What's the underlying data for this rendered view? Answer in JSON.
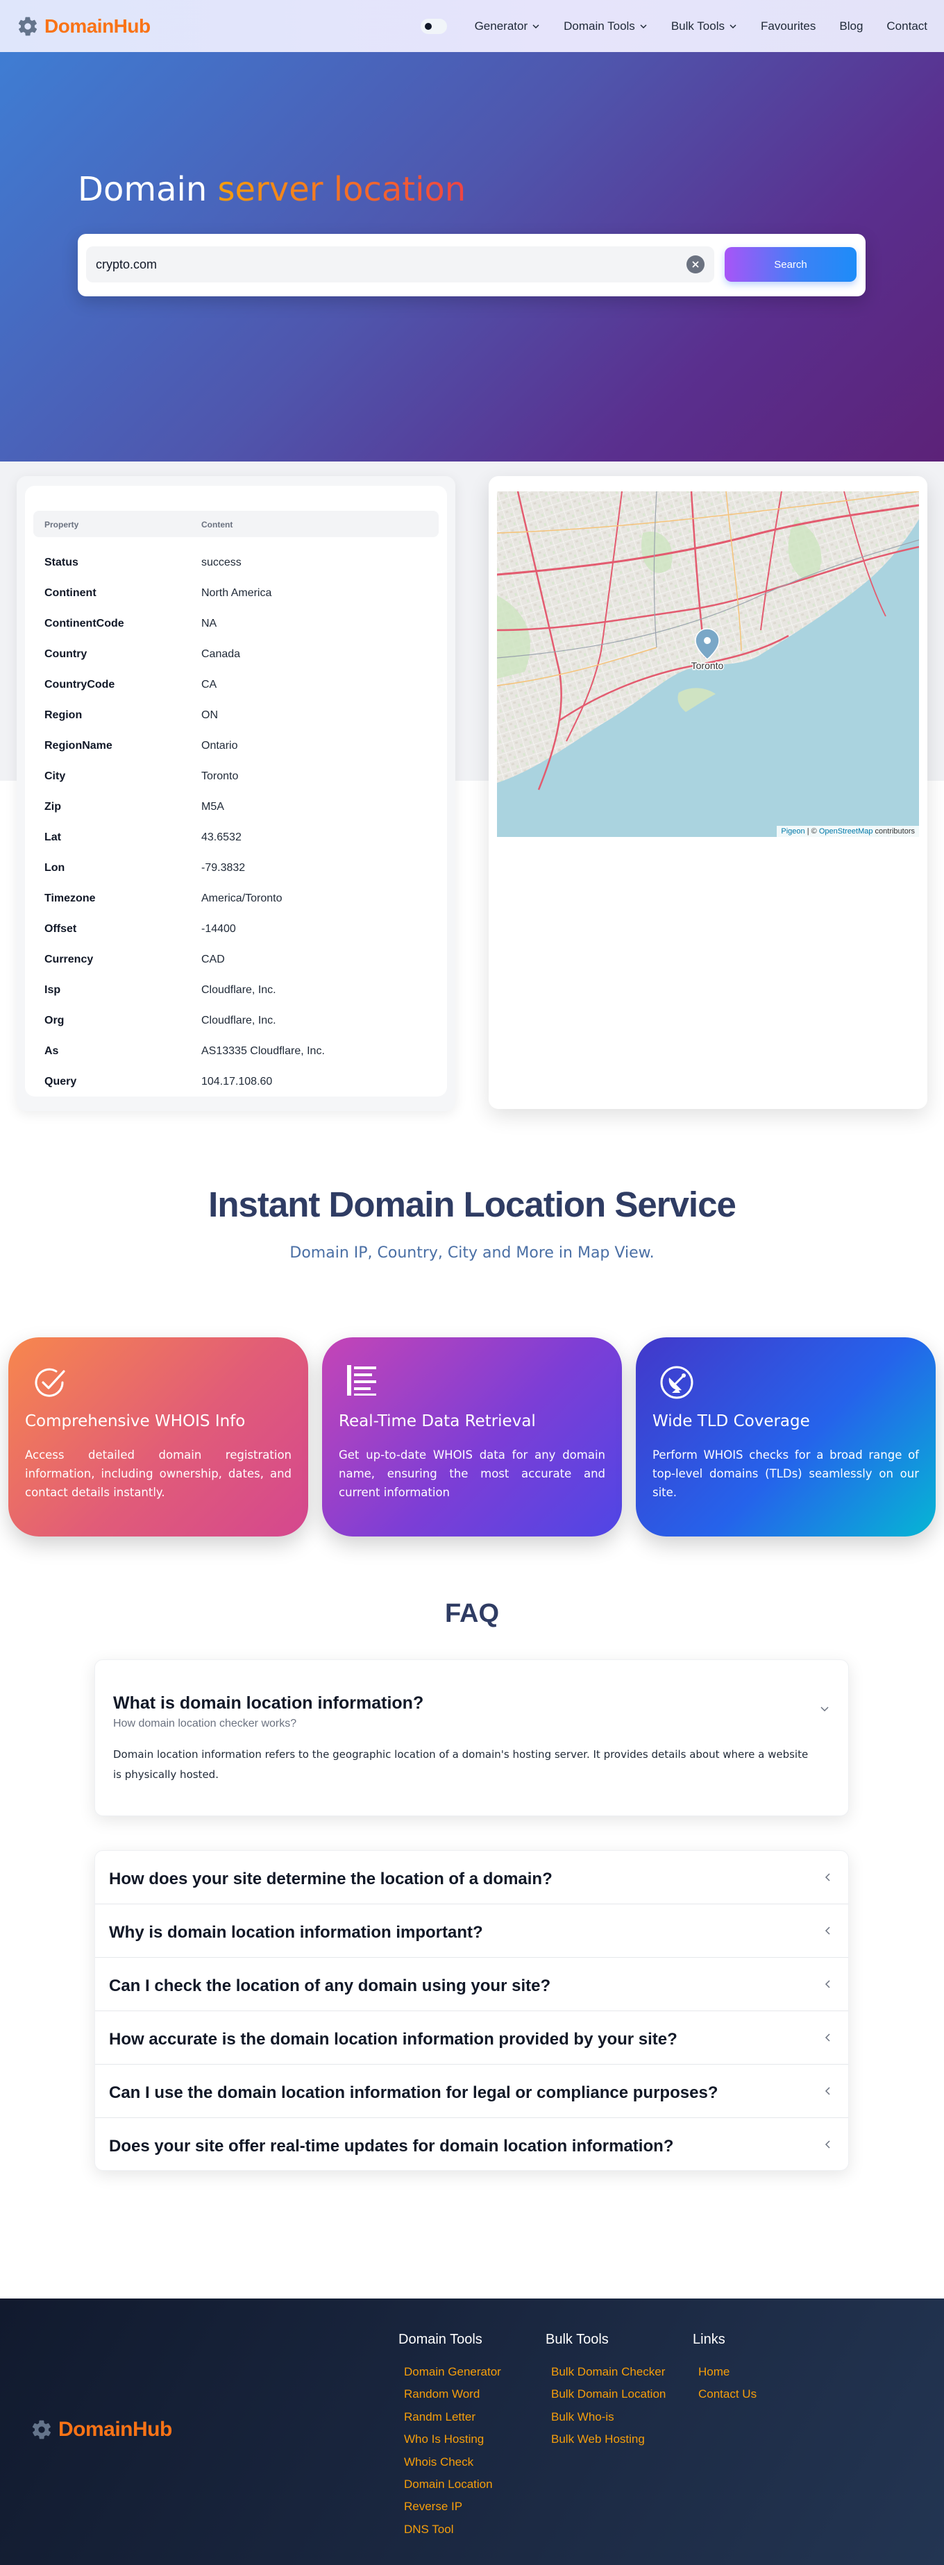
{
  "brand": {
    "name": "DomainHub",
    "logo_icon": "gear-icon"
  },
  "nav": {
    "items": [
      {
        "label": "Generator",
        "dropdown": true
      },
      {
        "label": "Domain Tools",
        "dropdown": true
      },
      {
        "label": "Bulk Tools",
        "dropdown": true
      },
      {
        "label": "Favourites",
        "dropdown": false
      },
      {
        "label": "Blog",
        "dropdown": false
      },
      {
        "label": "Contact",
        "dropdown": false
      }
    ]
  },
  "hero": {
    "title_plain": "Domain",
    "title_accent": "server location",
    "search_value": "crypto.com",
    "search_button": "Search"
  },
  "table": {
    "header_property": "Property",
    "header_content": "Content",
    "rows": [
      {
        "k": "Status",
        "v": "success"
      },
      {
        "k": "Continent",
        "v": "North America"
      },
      {
        "k": "ContinentCode",
        "v": "NA"
      },
      {
        "k": "Country",
        "v": "Canada"
      },
      {
        "k": "CountryCode",
        "v": "CA"
      },
      {
        "k": "Region",
        "v": "ON"
      },
      {
        "k": "RegionName",
        "v": "Ontario"
      },
      {
        "k": "City",
        "v": "Toronto"
      },
      {
        "k": "Zip",
        "v": "M5A"
      },
      {
        "k": "Lat",
        "v": "43.6532"
      },
      {
        "k": "Lon",
        "v": "-79.3832"
      },
      {
        "k": "Timezone",
        "v": "America/Toronto"
      },
      {
        "k": "Offset",
        "v": "-14400"
      },
      {
        "k": "Currency",
        "v": "CAD"
      },
      {
        "k": "Isp",
        "v": "Cloudflare, Inc."
      },
      {
        "k": "Org",
        "v": "Cloudflare, Inc."
      },
      {
        "k": "As",
        "v": "AS13335 Cloudflare, Inc."
      },
      {
        "k": "Query",
        "v": "104.17.108.60"
      }
    ]
  },
  "map": {
    "marker_label": "Toronto",
    "attribution_pigeon": "Pigeon",
    "attribution_sep": " | © ",
    "attribution_osm": "OpenStreetMap",
    "attribution_tail": " contributors",
    "colors": {
      "land": "#e8e6e1",
      "water": "#aad3df",
      "highway": "#e35b6f"
    }
  },
  "service": {
    "title": "Instant Domain Location Service",
    "subtitle": "Domain IP, Country, City and More in Map View."
  },
  "features": [
    {
      "icon": "check-circle-icon",
      "title": "Comprehensive WHOIS Info",
      "text": "Access detailed domain registration information, including ownership, dates, and contact details instantly."
    },
    {
      "icon": "list-lines-icon",
      "title": "Real-Time Data Retrieval",
      "text": "Get up-to-date WHOIS data for any domain name, ensuring the most accurate and current information"
    },
    {
      "icon": "satellite-dish-icon",
      "title": "Wide TLD Coverage",
      "text": "Perform WHOIS checks for a broad range of top-level domains (TLDs) seamlessly on our site."
    }
  ],
  "faq": {
    "title": "FAQ",
    "open": {
      "question": "What is domain location information?",
      "subtitle": "How domain location checker works?",
      "answer": "Domain location information refers to the geographic location of a domain's hosting server. It provides details about where a website is physically hosted."
    },
    "items": [
      "How does your site determine the location of a domain?",
      "Why is domain location information important?",
      "Can I check the location of any domain using your site?",
      "How accurate is the domain location information provided by your site?",
      "Can I use the domain location information for legal or compliance purposes?",
      "Does your site offer real-time updates for domain location information?"
    ]
  },
  "footer": {
    "columns": [
      {
        "title": "Domain Tools",
        "links": [
          "Domain Generator",
          "Random Word",
          "Randm Letter",
          "Who Is Hosting",
          "Whois Check",
          "Domain Location",
          "Reverse IP",
          "DNS Tool"
        ]
      },
      {
        "title": "Bulk Tools",
        "links": [
          "Bulk Domain Checker",
          "Bulk Domain Location",
          "Bulk Who-is",
          "Bulk Web Hosting"
        ]
      },
      {
        "title": "Links",
        "links": [
          "Home",
          "Contact Us"
        ]
      }
    ]
  }
}
